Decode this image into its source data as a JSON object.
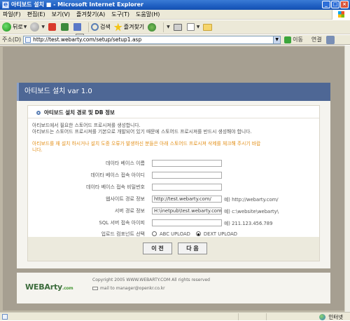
{
  "window": {
    "title": "아티보드 설치 ■ - Microsoft Internet Explorer",
    "controls": [
      "_",
      "□",
      "×"
    ]
  },
  "menu": {
    "items": [
      "파일(F)",
      "편집(E)",
      "보기(V)",
      "즐겨찾기(A)",
      "도구(T)",
      "도움말(H)"
    ]
  },
  "toolbar": {
    "back_label": "뒤로",
    "search_label": "검색",
    "favorites_label": "즐겨찾기"
  },
  "address": {
    "label": "주소(D)",
    "url": "http://test.webarty.com/setup/setup1.asp",
    "go_label": "이동",
    "links_label": "연결"
  },
  "page": {
    "header_title": "아티보드 설치 var 1.0",
    "section_title": "아티보드 설치 경로 및 DB 정보",
    "desc_line1": "아티보드에서 필요한 스토어드 프로시져를 생성합니다.",
    "desc_line2": "아티보드는 스토어드 프로시져를 기본으로 개발되어 있기 때문에 스토어드 프로시져를 반드시 생성해야 합니다.",
    "warn_line1": "아티보드를 재 설치 하시거나 설치 도중 오류가 발생하신 분들은 아래 스토어드 프로시져 삭제를 체크해 주시기 바랍",
    "warn_line2": "니다."
  },
  "form": {
    "db_name_label": "데이타 베이스 이름",
    "db_name_value": "",
    "db_id_label": "데이타 베이스 접속 아이디",
    "db_id_value": "",
    "db_pw_label": "데이타 베이스 접속 비밀번호",
    "db_pw_value": "",
    "site_label": "웹사이트 경로 정보",
    "site_value": "http://test.webarty.com/",
    "site_hint": "예) http://webarty.com/",
    "server_label": "서버 경로 정보",
    "server_value": "H:\\inetpub\\test.webarty.com",
    "server_hint": "예) c:\\website\\webarty\\",
    "sql_label": "SQL 서버 접속 아이피",
    "sql_value": "",
    "sql_hint": "예) 211.123.456.789",
    "upload_label": "업로드 컴포넌트 선택",
    "upload_options": [
      {
        "label": "ABC UPLOAD",
        "selected": false
      },
      {
        "label": "DEXT UPLOAD",
        "selected": true
      }
    ]
  },
  "buttons": {
    "prev": "이 전",
    "next": "다 음"
  },
  "footer": {
    "logo_main": "WEBArty",
    "logo_suffix": ".com",
    "copyright": "Copyright 2005 WWW.WEBARTY.COM All rights reserved",
    "mail": "mail to manager@openkr.co.kr"
  },
  "status": {
    "zone": "인터넷"
  }
}
